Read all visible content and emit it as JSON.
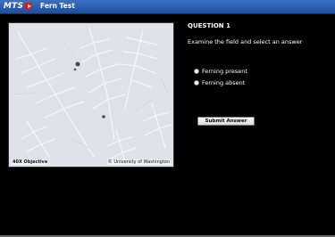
{
  "app": {
    "logo_text": "MTS",
    "title": "Fern Test"
  },
  "image": {
    "caption_left": "40X Objective",
    "caption_right": "© University of Washington"
  },
  "question": {
    "heading": "QUESTION 1",
    "prompt": "Examine the field and select an answer",
    "options": [
      {
        "label": "Ferning present",
        "selected": false
      },
      {
        "label": "Ferning absent",
        "selected": false
      }
    ],
    "submit_label": "Submit Answer"
  },
  "colors": {
    "background": "#000000",
    "titlebar": "#2b5db0",
    "logo_accent": "#d01f1f"
  },
  "icons": {
    "logo_icon": "play-icon"
  }
}
